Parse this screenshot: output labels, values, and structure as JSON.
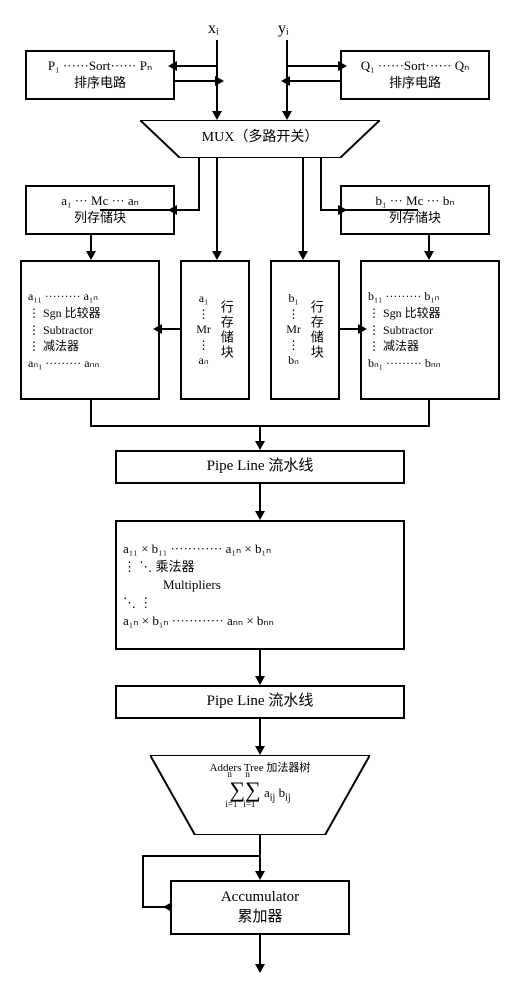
{
  "inputs": {
    "x": "xᵢ",
    "y": "yᵢ"
  },
  "sort_left": {
    "line1": "P₁ ······Sort······ Pₙ",
    "line2": "排序电路"
  },
  "sort_right": {
    "line1": "Q₁ ······Sort······ Qₙ",
    "line2": "排序电路"
  },
  "mux": "MUX（多路开关）",
  "col_store_left": {
    "line1": "a₁ ··· Mc ··· aₙ",
    "line2": "列存储块"
  },
  "col_store_right": {
    "line1": "b₁ ··· Mc ··· bₙ",
    "line2": "列存储块"
  },
  "row_store_left": {
    "items": "a₁\n⋮\nMr\n⋮\naₙ",
    "label": "行存储块"
  },
  "row_store_right": {
    "items": "b₁\n⋮\nMr\n⋮\nbₙ",
    "label": "行存储块"
  },
  "comparator_left": {
    "topline": "a₁₁ ········· a₁ₙ",
    "body1": "⋮ Sgn 比较器",
    "body2": "⋮ Subtractor",
    "body3": "⋮  减法器",
    "botline": "aₙ₁ ········· aₙₙ"
  },
  "comparator_right": {
    "topline": "b₁₁ ········· b₁ₙ",
    "body1": "⋮ Sgn 比较器",
    "body2": "⋮ Subtractor",
    "body3": "⋮  减法器",
    "botline": "bₙ₁ ········· bₙₙ"
  },
  "pipeline1": "Pipe Line 流水线",
  "multipliers": {
    "topline": "a₁₁ × b₁₁ ············ a₁ₙ × b₁ₙ",
    "mid1": "⋮      ⋱ 乘法器",
    "mid2": "       Multipliers",
    "mid3": "             ⋱        ⋮",
    "botline": "a₁ₙ × b₁ₙ ············ aₙₙ × bₙₙ"
  },
  "pipeline2": "Pipe Line 流水线",
  "adder_tree": {
    "title": "Adders Tree 加法器树",
    "formula": "∑∑ aᵢⱼ bᵢⱼ",
    "limits": "i=1..n, i=1..n"
  },
  "accumulator": {
    "en": "Accumulator",
    "cn": "累加器"
  }
}
